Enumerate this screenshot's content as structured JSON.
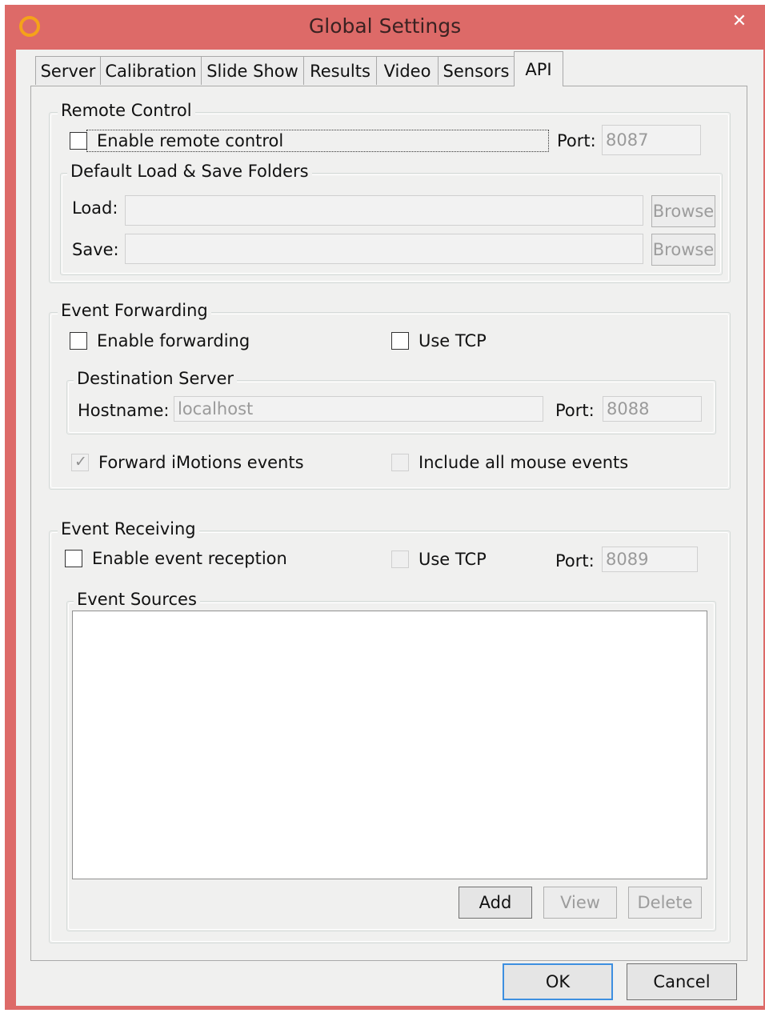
{
  "window": {
    "title": "Global Settings",
    "close_glyph": "✕",
    "app_icon": "ring-icon"
  },
  "tabs": [
    {
      "label": "Server",
      "active": false
    },
    {
      "label": "Calibration",
      "active": false
    },
    {
      "label": "Slide Show",
      "active": false
    },
    {
      "label": "Results",
      "active": false
    },
    {
      "label": "Video",
      "active": false
    },
    {
      "label": "Sensors",
      "active": false
    },
    {
      "label": "API",
      "active": true
    }
  ],
  "remote_control": {
    "legend": "Remote Control",
    "enable_label": "Enable remote control",
    "enable_checked": false,
    "port_label": "Port:",
    "port_value": "8087",
    "folders": {
      "legend": "Default Load & Save Folders",
      "load_label": "Load:",
      "load_value": "",
      "save_label": "Save:",
      "save_value": "",
      "browse_label": "Browse"
    }
  },
  "event_forwarding": {
    "legend": "Event Forwarding",
    "enable_label": "Enable forwarding",
    "enable_checked": false,
    "use_tcp_label": "Use TCP",
    "use_tcp_checked": false,
    "destination": {
      "legend": "Destination Server",
      "hostname_label": "Hostname:",
      "hostname_value": "localhost",
      "port_label": "Port:",
      "port_value": "8088"
    },
    "forward_imotions_label": "Forward iMotions events",
    "forward_imotions_checked": true,
    "include_mouse_label": "Include all mouse events",
    "include_mouse_checked": false
  },
  "event_receiving": {
    "legend": "Event Receiving",
    "enable_label": "Enable event reception",
    "enable_checked": false,
    "use_tcp_label": "Use TCP",
    "use_tcp_checked": false,
    "port_label": "Port:",
    "port_value": "8089",
    "sources": {
      "legend": "Event Sources",
      "items": [],
      "add_label": "Add",
      "view_label": "View",
      "delete_label": "Delete"
    }
  },
  "footer": {
    "ok_label": "OK",
    "cancel_label": "Cancel"
  },
  "colors": {
    "titlebar": "#dd6a68",
    "client": "#f0f0ef",
    "focus": "#3d8fe0",
    "app_icon": "#f5a21a"
  }
}
